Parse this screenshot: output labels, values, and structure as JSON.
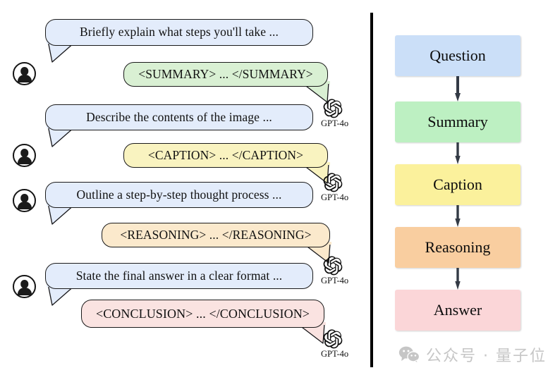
{
  "figure": {
    "divider_color": "#000000",
    "background": "#ffffff"
  },
  "conversation": {
    "user_icon_name": "user-avatar-icon",
    "assistant_icon_name": "openai-logo-icon",
    "assistant_label": "GPT-4o",
    "turns": [
      {
        "role": "user",
        "text": "Briefly explain what steps you'll take ...",
        "color": "#e3ecfb",
        "border": "#17171a"
      },
      {
        "role": "assistant",
        "text": "<SUMMARY> ... </SUMMARY>",
        "color": "#d9f0d3",
        "border": "#17171a"
      },
      {
        "role": "user",
        "text": "Describe the contents of the image ...",
        "color": "#e3ecfb",
        "border": "#17171a"
      },
      {
        "role": "assistant",
        "text": "<CAPTION> ... </CAPTION>",
        "color": "#f9f3c0",
        "border": "#17171a"
      },
      {
        "role": "user",
        "text": "Outline a step-by-step thought process ...",
        "color": "#e3ecfb",
        "border": "#17171a"
      },
      {
        "role": "assistant",
        "text": "<REASONING> ... </REASONING>",
        "color": "#fbe9cc",
        "border": "#17171a"
      },
      {
        "role": "user",
        "text": "State the final answer in a clear format ...",
        "color": "#e3ecfb",
        "border": "#17171a"
      },
      {
        "role": "assistant",
        "text": "<CONCLUSION> ... </CONCLUSION>",
        "color": "#fae3e1",
        "border": "#17171a"
      }
    ]
  },
  "flowchart": {
    "arrow_color": "#333a45",
    "steps": [
      {
        "label": "Question",
        "color": "#cbdff8"
      },
      {
        "label": "Summary",
        "color": "#bdf0c2"
      },
      {
        "label": "Caption",
        "color": "#fbf19c"
      },
      {
        "label": "Reasoning",
        "color": "#f9ceA0"
      },
      {
        "label": "Answer",
        "color": "#fbd6d8"
      }
    ]
  },
  "watermark": {
    "icon_name": "wechat-icon",
    "text": "公众号 · 量子位",
    "color": "#c6c6c6"
  }
}
